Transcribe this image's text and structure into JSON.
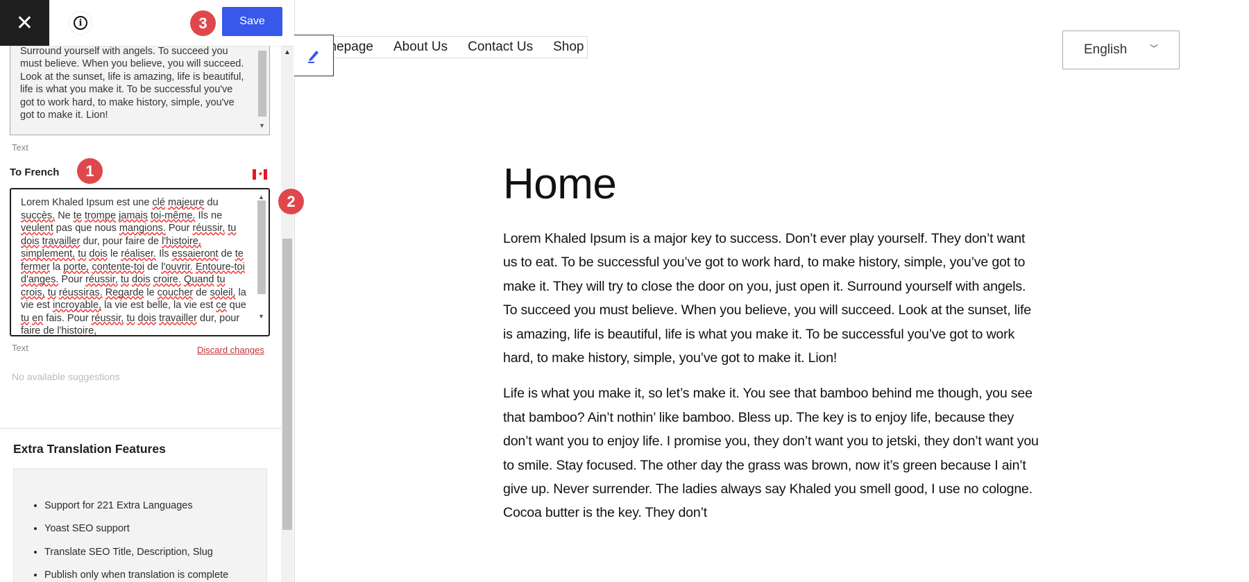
{
  "topbar": {
    "close_icon": "close-icon",
    "info_icon": "info-icon",
    "save_label": "Save"
  },
  "badges": [
    "1",
    "2",
    "3"
  ],
  "source": {
    "text": "They will try to close the door on you, just open it. Surround yourself with angels. To succeed you must believe. When you believe, you will succeed. Look at the sunset, life is amazing, life is beautiful, life is what you make it. To be successful you've got to work hard, to make history, simple, you've got to make it. Lion!",
    "type_label": "Text"
  },
  "translation": {
    "heading": "To French",
    "flag": "canada-flag-icon",
    "text": "Lorem Khaled Ipsum est une clé majeure du succès. Ne te trompe jamais toi-même. Ils ne veulent pas que nous mangions. Pour réussir, tu dois travailler dur, pour faire de l'histoire, simplement, tu dois le réaliser. Ils essaieront de te fermer la porte, contente-toi de l'ouvrir. Entoure-toi d'anges. Pour réussir, tu dois croire. Quand tu crois, tu réussiras. Regarde le coucher de soleil, la vie est incroyable, la vie est belle, la vie est ce que tu en fais. Pour réussir, tu dois travailler dur, pour faire de l'histoire,",
    "type_label": "Text",
    "discard_label": "Discard changes",
    "suggestions": "No available suggestions"
  },
  "extra": {
    "title": "Extra Translation Features",
    "items": [
      "Support for 221 Extra Languages",
      "Yoast SEO support",
      "Translate SEO Title, Description, Slug",
      "Publish only when translation is complete"
    ]
  },
  "nav": {
    "items": [
      "Homepage",
      "About Us",
      "Contact Us",
      "Shop"
    ]
  },
  "language": {
    "selected": "English"
  },
  "page": {
    "title": "Home",
    "paragraphs": [
      "Lorem Khaled Ipsum is a major key to success. Don’t ever play yourself. They don’t want us to eat. To be successful you’ve got to work hard, to make history, simple, you’ve got to make it. They will try to close the door on you, just open it. Surround yourself with angels. To succeed you must believe. When you believe, you will succeed. Look at the sunset, life is amazing, life is beautiful, life is what you make it. To be successful you’ve got to work hard, to make history, simple, you’ve got to make it. Lion!",
      "Life is what you make it, so let’s make it. You see that bamboo behind me though, you see that bamboo? Ain’t nothin’ like bamboo. Bless up. The key is to enjoy life, because they don’t want you to enjoy life. I promise you, they don’t want you to jetski, they don’t want you to smile. Stay focused. The other day the grass was brown, now it’s green because I ain’t give up. Never surrender. The ladies always say Khaled you smell good, I use no cologne. Cocoa butter is the key. They don’t"
    ]
  },
  "colors": {
    "accent": "#3858e9",
    "badge": "#e0474c",
    "discard": "#c0333a"
  }
}
